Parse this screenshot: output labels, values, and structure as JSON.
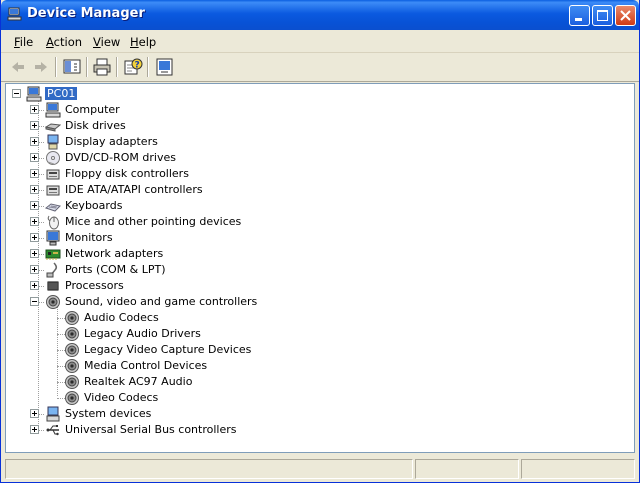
{
  "window": {
    "title": "Device Manager",
    "accent": "#0a5fe0"
  },
  "menu": [
    {
      "label": "File",
      "key": "F",
      "rest": "ile"
    },
    {
      "label": "Action",
      "key": "A",
      "rest": "ction"
    },
    {
      "label": "View",
      "key": "V",
      "rest": "iew"
    },
    {
      "label": "Help",
      "key": "H",
      "rest": "elp"
    }
  ],
  "toolbar": {
    "buttons": [
      "back-icon",
      "forward-icon",
      "show-hide-console-tree-icon",
      "print-icon",
      "help-icon",
      "properties-icon"
    ]
  },
  "tree": {
    "root": {
      "label": "PC01",
      "icon": "computer-icon",
      "expanded": true
    },
    "categories": [
      {
        "label": "Computer",
        "icon": "computer-icon"
      },
      {
        "label": "Disk drives",
        "icon": "disk-drive-icon"
      },
      {
        "label": "Display adapters",
        "icon": "display-adapter-icon"
      },
      {
        "label": "DVD/CD-ROM drives",
        "icon": "cdrom-icon"
      },
      {
        "label": "Floppy disk controllers",
        "icon": "floppy-controller-icon"
      },
      {
        "label": "IDE ATA/ATAPI controllers",
        "icon": "ide-controller-icon"
      },
      {
        "label": "Keyboards",
        "icon": "keyboard-icon"
      },
      {
        "label": "Mice and other pointing devices",
        "icon": "mouse-icon"
      },
      {
        "label": "Monitors",
        "icon": "monitor-icon"
      },
      {
        "label": "Network adapters",
        "icon": "network-adapter-icon"
      },
      {
        "label": "Ports (COM & LPT)",
        "icon": "port-icon"
      },
      {
        "label": "Processors",
        "icon": "processor-icon"
      },
      {
        "label": "Sound, video and game controllers",
        "icon": "speaker-icon",
        "expanded": true,
        "children": [
          {
            "label": "Audio Codecs",
            "icon": "speaker-icon"
          },
          {
            "label": "Legacy Audio Drivers",
            "icon": "speaker-icon"
          },
          {
            "label": "Legacy Video Capture Devices",
            "icon": "speaker-icon"
          },
          {
            "label": "Media Control Devices",
            "icon": "speaker-icon"
          },
          {
            "label": "Realtek AC97 Audio",
            "icon": "speaker-icon"
          },
          {
            "label": "Video Codecs",
            "icon": "speaker-icon"
          }
        ]
      },
      {
        "label": "System devices",
        "icon": "system-device-icon"
      },
      {
        "label": "Universal Serial Bus controllers",
        "icon": "usb-icon"
      }
    ]
  }
}
